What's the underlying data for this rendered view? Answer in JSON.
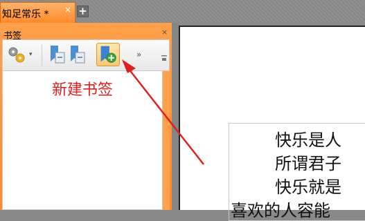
{
  "tab": {
    "title": "知足常乐 *",
    "close": "×",
    "new": "+"
  },
  "panel": {
    "title": "书签",
    "close": "×",
    "toolbar": {
      "settings_caret": "▾",
      "more": "»"
    }
  },
  "annotation": {
    "text": "新建书签"
  },
  "document": {
    "lines": [
      "快乐是人",
      "所谓君子",
      "快乐就是",
      "喜欢的人容能"
    ]
  },
  "colors": {
    "accent": "#ff8a2a",
    "annotation": "#e02020"
  }
}
